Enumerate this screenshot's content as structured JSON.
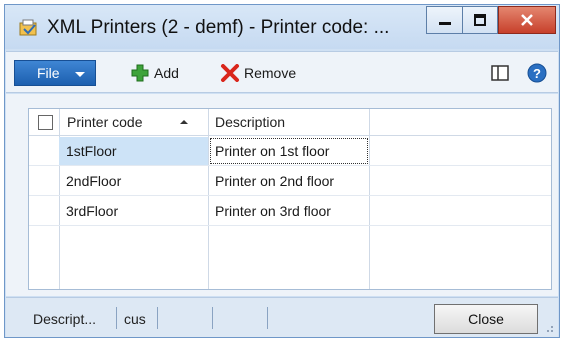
{
  "window": {
    "title": "XML Printers (2 - demf) - Printer code: ...",
    "icons": {
      "app": "app-icon",
      "minimize": "minimize-icon",
      "maximize": "maximize-icon",
      "close": "close-icon"
    }
  },
  "toolbar": {
    "file_label": "File",
    "add_label": "Add",
    "remove_label": "Remove",
    "icons": {
      "add": "plus-icon",
      "remove": "x-icon",
      "layout": "layout-icon",
      "help": "help-icon"
    },
    "colors": {
      "file_button": "#2a6fc2",
      "add_icon": "#3da33a",
      "remove_icon": "#d9261c"
    }
  },
  "grid": {
    "columns": [
      "Printer code",
      "Description"
    ],
    "sort": {
      "column": "Printer code",
      "direction": "ascending"
    },
    "rows": [
      {
        "code": "1stFloor",
        "description": "Printer on 1st floor",
        "selected": true
      },
      {
        "code": "2ndFloor",
        "description": "Printer on 2nd floor",
        "selected": false
      },
      {
        "code": "3rdFloor",
        "description": "Printer on 3rd floor",
        "selected": false
      }
    ]
  },
  "statusbar": {
    "segments": [
      "Descript...",
      "cus",
      "",
      "",
      ""
    ],
    "close_label": "Close"
  }
}
